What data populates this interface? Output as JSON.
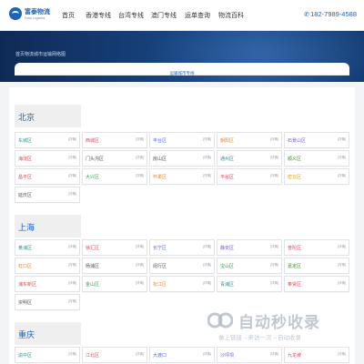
{
  "brand": {
    "name": "富泰物流",
    "tagline": "Futai Logistics"
  },
  "nav": [
    "首页",
    "香港专线",
    "台湾专线",
    "澳门专线",
    "运单查询",
    "物流百科"
  ],
  "phone": "182-7989-4588",
  "breadcrumb": "首页物流城市运输网络图",
  "tab": "运输城市专线",
  "detail_label": "[详情]",
  "colors": {
    "brand": "#1d63b8",
    "banner_dark": "#0f2a56",
    "banner_light": "#1e4f90"
  },
  "cities": [
    {
      "name": "北京",
      "districts": [
        "东城区",
        "西城区",
        "丰台区",
        "朝阳区",
        "石景山区",
        "海淀区",
        "门头沟区",
        "房山区",
        "通州区",
        "顺义区",
        "昌平区",
        "大兴区",
        "怀柔区",
        "平谷区",
        "密云区",
        "延庆区"
      ]
    },
    {
      "name": "上海",
      "districts": [
        "黄浦区",
        "徐汇区",
        "长宁区",
        "静安区",
        "普陀区",
        "虹口区",
        "杨浦区",
        "闵行区",
        "宝山区",
        "嘉定区",
        "浦东新区",
        "金山区",
        "松江区",
        "青浦区",
        "奉贤区",
        "崇明区"
      ]
    },
    {
      "name": "重庆",
      "districts": [
        "渝中区",
        "江北区",
        "大渡口",
        "沙坪坝",
        "九龙坡"
      ]
    }
  ],
  "watermark": {
    "main": "自动秒收录",
    "sub": "做上链接→来访一次→自动收录"
  }
}
